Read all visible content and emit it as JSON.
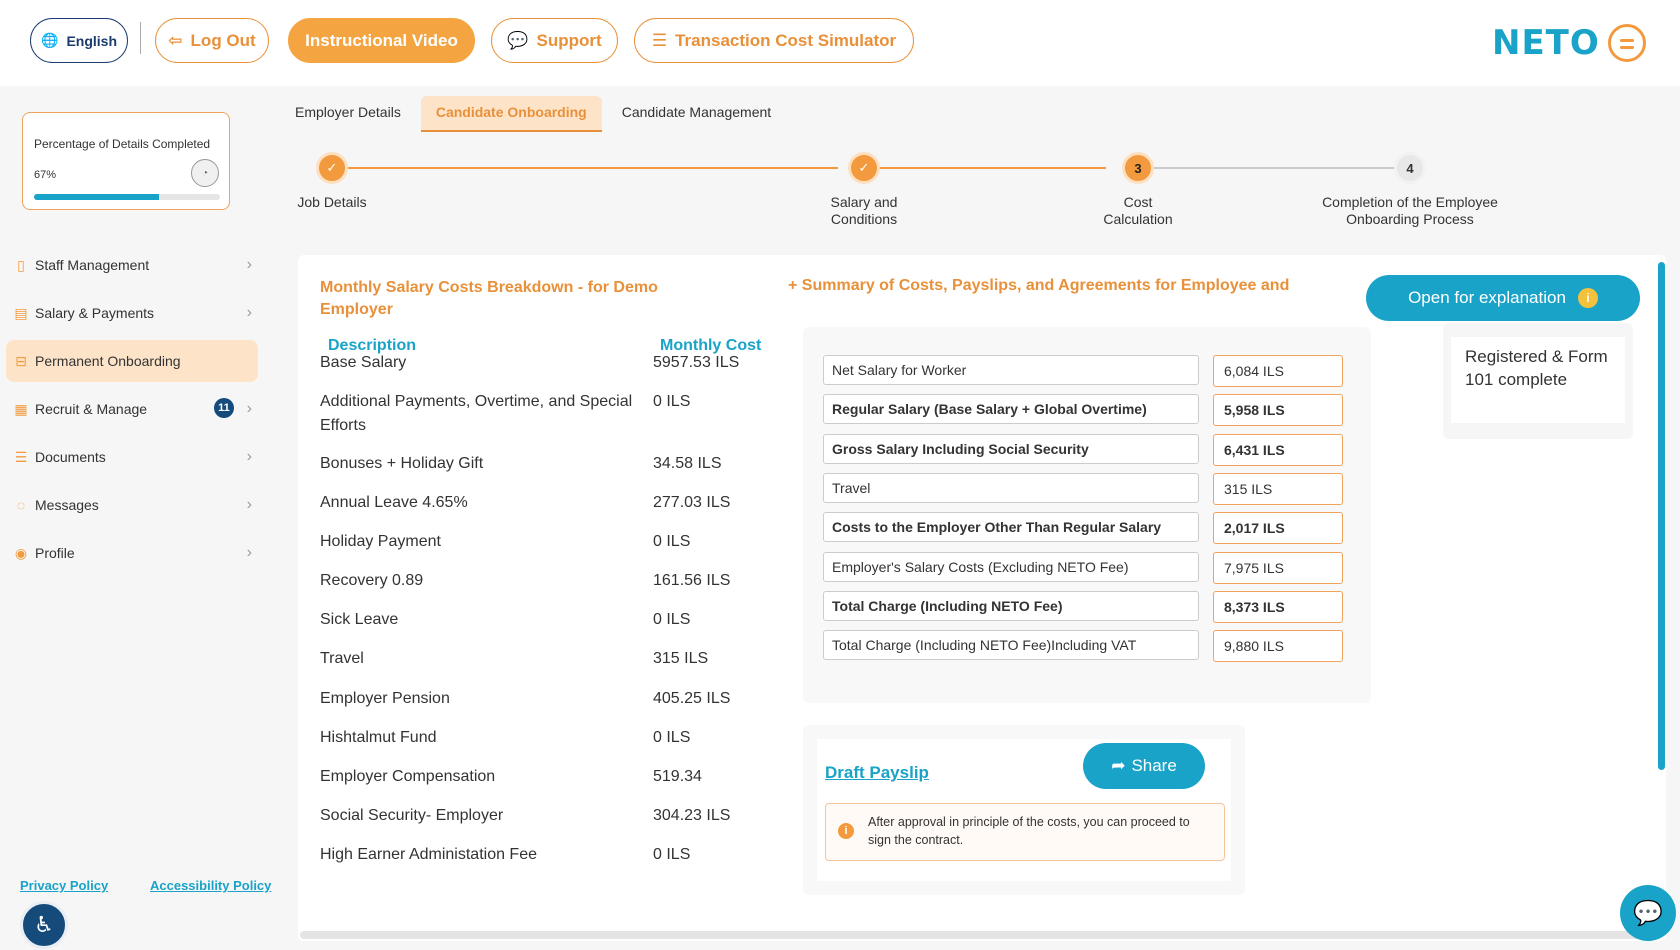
{
  "header": {
    "language_label": "English",
    "logout_label": "Log Out",
    "video_label": "Instructional Video",
    "support_label": "Support",
    "simulator_label": "Transaction Cost Simulator",
    "logo_text": "NETO"
  },
  "progress": {
    "label": "Percentage of Details Completed",
    "percent_text": "67%",
    "fraction": 0.67
  },
  "sidebar": {
    "items": [
      {
        "label": "Staff Management",
        "icon": "document-icon"
      },
      {
        "label": "Salary & Payments",
        "icon": "payslip-icon"
      },
      {
        "label": "Permanent Onboarding",
        "icon": "briefcase-icon"
      },
      {
        "label": "Recruit & Manage",
        "icon": "grid-icon",
        "badge": "11"
      },
      {
        "label": "Documents",
        "icon": "files-icon"
      },
      {
        "label": "Messages",
        "icon": "chat-icon"
      },
      {
        "label": "Profile",
        "icon": "user-icon"
      }
    ],
    "privacy_link": "Privacy Policy",
    "accessibility_link": "Accessibility Policy"
  },
  "tabs": [
    "Employer Details",
    "Candidate Onboarding",
    "Candidate Management"
  ],
  "steps": [
    {
      "number": "✓",
      "label": "Job Details",
      "state": "done"
    },
    {
      "number": "✓",
      "label": "Salary and Conditions",
      "state": "done"
    },
    {
      "number": "3",
      "label": "Cost Calculation",
      "state": "current"
    },
    {
      "number": "4",
      "label": "Completion of the Employee Onboarding Process",
      "state": "todo"
    }
  ],
  "breakdown": {
    "title": "Monthly Salary Costs Breakdown - for Demo Employer",
    "col_description": "Description",
    "col_cost": "Monthly Cost",
    "rows": [
      {
        "desc": "Base Salary",
        "value": "5957.53 ILS"
      },
      {
        "desc": "Additional Payments, Overtime, and Special Efforts",
        "value": "0 ILS"
      },
      {
        "desc": "Bonuses + Holiday Gift",
        "value": "34.58 ILS"
      },
      {
        "desc": "Annual Leave 4.65%",
        "value": "277.03 ILS"
      },
      {
        "desc": "Holiday Payment",
        "value": "0 ILS"
      },
      {
        "desc": "Recovery 0.89",
        "value": "161.56 ILS"
      },
      {
        "desc": "Sick Leave",
        "value": "0 ILS"
      },
      {
        "desc": "Travel",
        "value": "315 ILS"
      },
      {
        "desc": "Employer Pension",
        "value": "405.25 ILS"
      },
      {
        "desc": "Hishtalmut Fund",
        "value": "0 ILS"
      },
      {
        "desc": "Employer Compensation",
        "value": "519.34"
      },
      {
        "desc": "Social Security- Employer",
        "value": "304.23 ILS"
      },
      {
        "desc": "High Earner Administation Fee",
        "value": "0 ILS"
      }
    ]
  },
  "summary": {
    "title": "+ Summary of Costs, Payslips, and Agreements for Employee and",
    "explain_button": "Open for explanation",
    "rows": [
      {
        "label": "Net Salary for Worker",
        "value": "6,084 ILS",
        "bold": false
      },
      {
        "label": "Regular Salary (Base Salary + Global Overtime)",
        "value": "5,958 ILS",
        "bold": true
      },
      {
        "label": "Gross Salary Including Social Security",
        "value": "6,431 ILS",
        "bold": true
      },
      {
        "label": "Travel",
        "value": "315 ILS",
        "bold": false
      },
      {
        "label": "Costs to the Employer Other Than Regular Salary",
        "value": "2,017 ILS",
        "bold": true
      },
      {
        "label": "Employer's Salary Costs (Excluding NETO Fee)",
        "value": "7,975 ILS",
        "bold": false
      },
      {
        "label": "Total Charge (Including NETO Fee)",
        "value": "8,373 ILS",
        "bold": true
      },
      {
        "label": "Total Charge (Including NETO Fee)Including VAT",
        "value": "9,880 ILS",
        "bold": false
      }
    ],
    "status_text": "Registered & Form 101 complete"
  },
  "payslip": {
    "draft_link": "Draft Payslip",
    "share_label": "Share",
    "note": "After approval in principle of the costs, you can proceed to sign the contract."
  },
  "colors": {
    "accent_orange": "#f29a3d",
    "accent_blue": "#1aa3c8",
    "navy": "#144b7a"
  }
}
